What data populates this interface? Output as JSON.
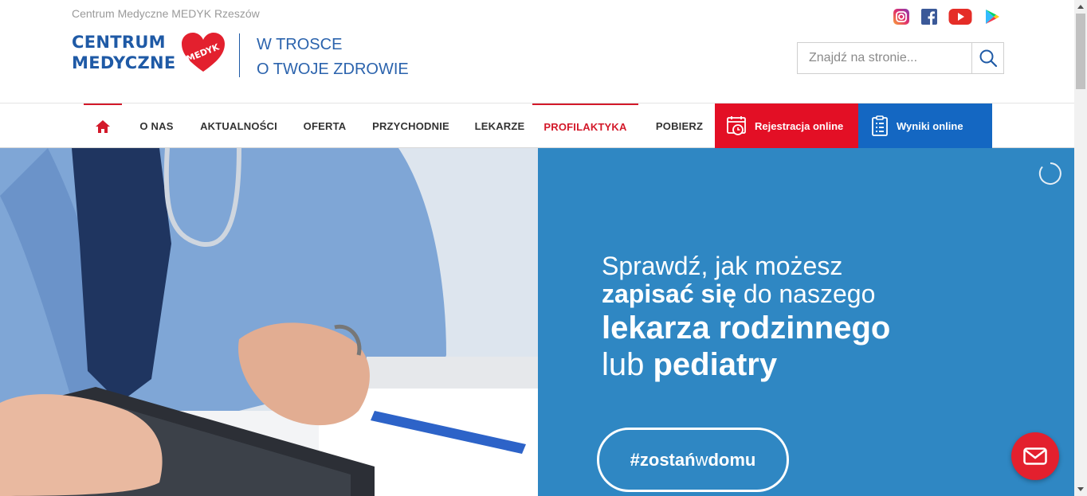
{
  "header": {
    "site_name": "Centrum Medyczne MEDYK Rzeszów",
    "logo_line1": "CENTRUM",
    "logo_line2": "MEDYCZNE",
    "logo_badge": "MEDYK",
    "tagline_line1": "W TROSCE",
    "tagline_line2": "O TWOJE ZDROWIE",
    "social_icons": [
      "instagram-icon",
      "facebook-icon",
      "youtube-icon",
      "google-play-icon"
    ],
    "search_placeholder": "Znajdź na stronie..."
  },
  "nav": {
    "items": [
      {
        "label": "O NAS"
      },
      {
        "label": "AKTUALNOŚCI"
      },
      {
        "label": "OFERTA"
      },
      {
        "label": "PRZYCHODNIE"
      },
      {
        "label": "LEKARZE"
      },
      {
        "label": "PROFILAKTYKA",
        "active": true
      },
      {
        "label": "POBIERZ"
      }
    ],
    "registration_label": "Rejestracja online",
    "results_label": "Wyniki online"
  },
  "hero": {
    "line1": "Sprawdź, jak możesz",
    "line2_bold": "zapisać się",
    "line2_rest": " do naszego",
    "line3": "lekarza rodzinnego",
    "line4_light": "lub ",
    "line4_bold": "pediatry",
    "hashtag_pre": "#zostań",
    "hashtag_mid": "w",
    "hashtag_post": "domu"
  },
  "colors": {
    "brand_blue": "#1f5aa6",
    "brand_red": "#e30f25",
    "results_blue": "#1467c2",
    "hero_blue": "#2f87c3"
  }
}
